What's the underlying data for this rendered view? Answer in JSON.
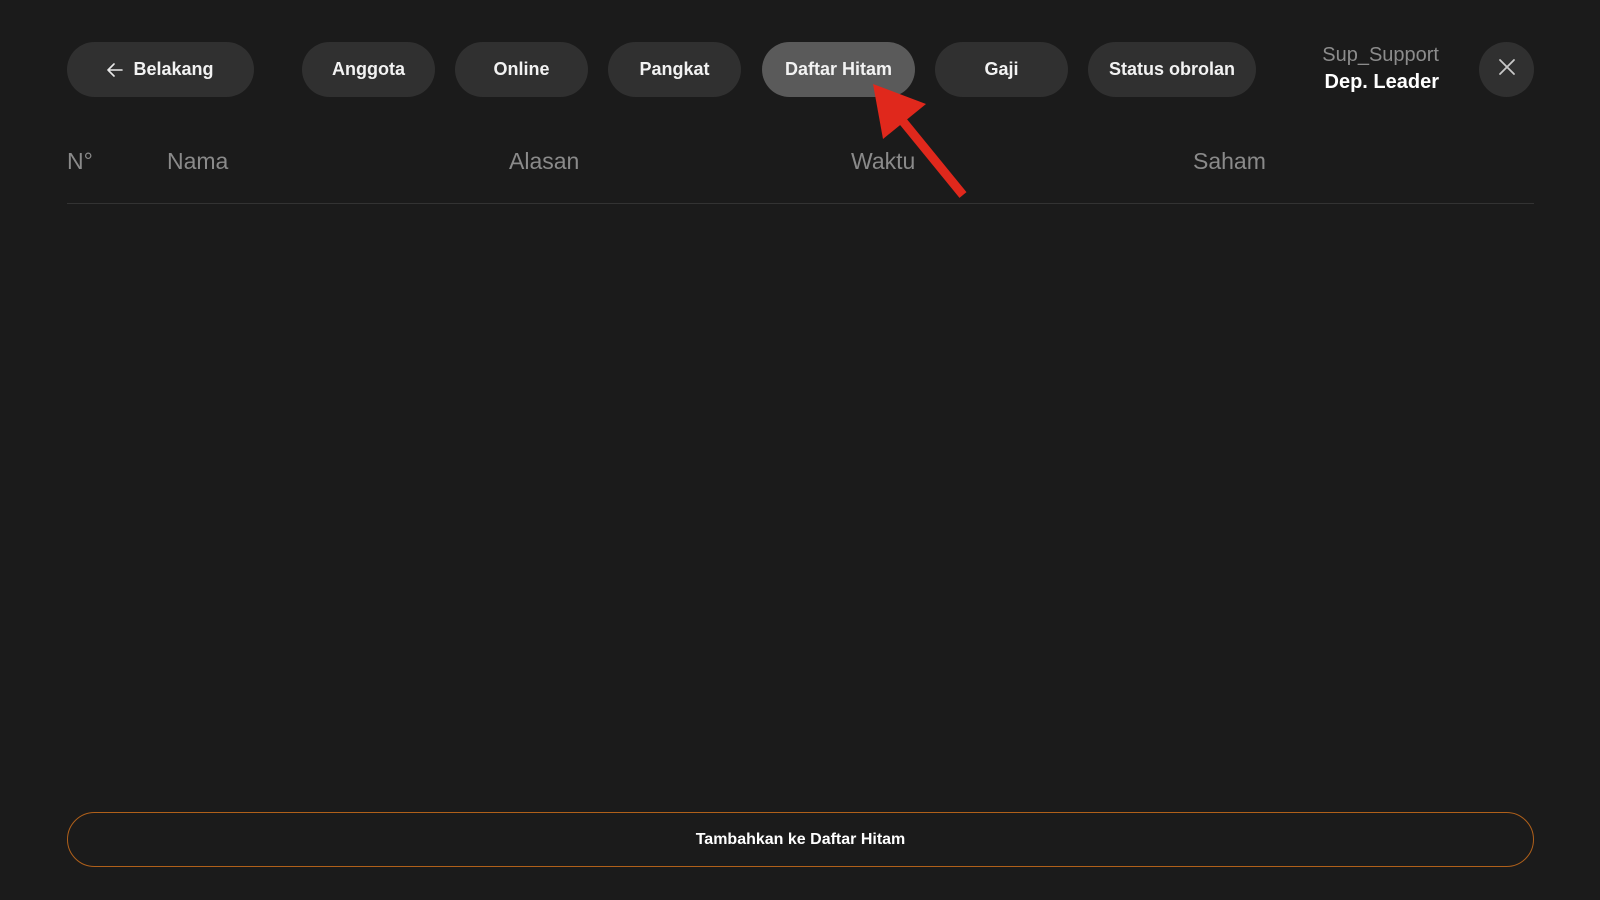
{
  "nav": {
    "back_label": "Belakang",
    "tabs": [
      {
        "label": "Anggota",
        "active": false
      },
      {
        "label": "Online",
        "active": false
      },
      {
        "label": "Pangkat",
        "active": false
      },
      {
        "label": "Daftar Hitam",
        "active": true
      },
      {
        "label": "Gaji",
        "active": false
      },
      {
        "label": "Status obrolan",
        "active": false
      }
    ],
    "close_icon": "close-icon",
    "back_icon": "arrow-left-icon"
  },
  "user": {
    "name": "Sup_Support",
    "role": "Dep. Leader"
  },
  "table": {
    "columns": [
      "N°",
      "Nama",
      "Alasan",
      "Waktu",
      "Saham"
    ],
    "rows": []
  },
  "footer": {
    "add_label": "Tambahkan ke Daftar Hitam"
  },
  "colors": {
    "background": "#1b1b1b",
    "button": "#303030",
    "button_active": "#5a5a5a",
    "accent_border": "#b0601a",
    "annotation_arrow": "#e0281c"
  }
}
